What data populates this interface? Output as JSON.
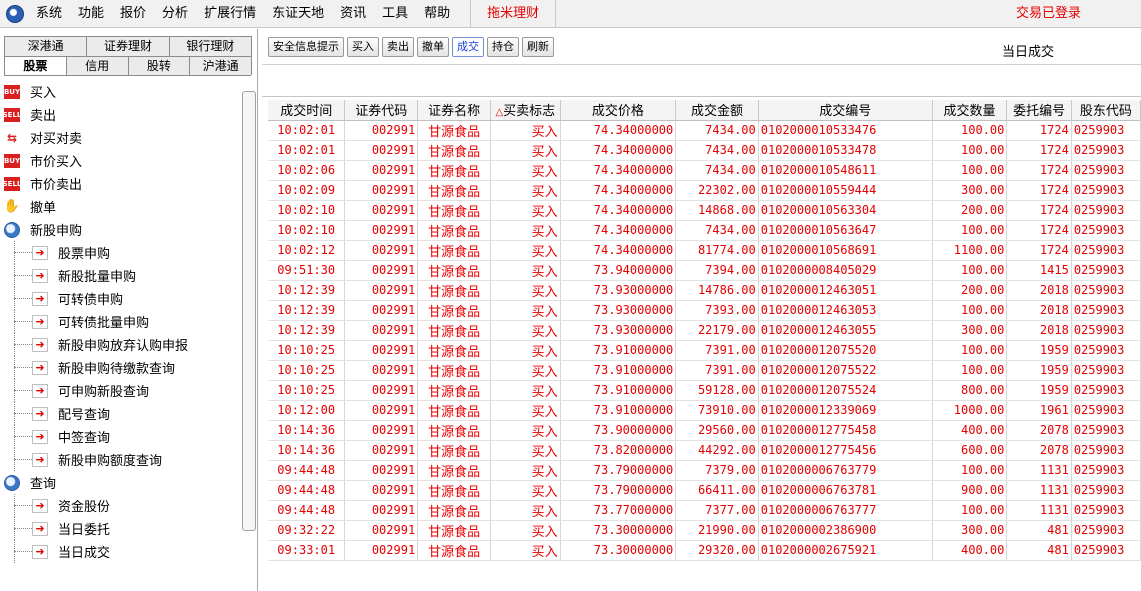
{
  "menubar": {
    "items": [
      "系统",
      "功能",
      "报价",
      "分析",
      "扩展行情",
      "东证天地",
      "资讯",
      "工具",
      "帮助"
    ],
    "tuomi": "拖米理财",
    "login_status": "交易已登录"
  },
  "left": {
    "tabs_row1": [
      "深港通",
      "证券理财",
      "银行理财"
    ],
    "tabs_row2": [
      "股票",
      "信用",
      "股转",
      "沪港通"
    ],
    "tree": [
      {
        "label": "买入",
        "icon": "buy-icon",
        "icon_text": "BUY"
      },
      {
        "label": "卖出",
        "icon": "sell-icon",
        "icon_text": "SELL"
      },
      {
        "label": "对买对卖",
        "icon": "swap-icon",
        "icon_text": "⇆"
      },
      {
        "label": "市价买入",
        "icon": "buy-icon",
        "icon_text": "BUY"
      },
      {
        "label": "市价卖出",
        "icon": "sell-icon",
        "icon_text": "SELL"
      },
      {
        "label": "撤单",
        "icon": "hand-icon",
        "icon_text": "✋"
      },
      {
        "label": "新股申购",
        "icon": "magnifier-icon"
      },
      {
        "label": "股票申购",
        "sub": true
      },
      {
        "label": "新股批量申购",
        "sub": true
      },
      {
        "label": "可转债申购",
        "sub": true
      },
      {
        "label": "可转债批量申购",
        "sub": true
      },
      {
        "label": "新股申购放弃认购申报",
        "sub": true
      },
      {
        "label": "新股申购待缴款查询",
        "sub": true
      },
      {
        "label": "可申购新股查询",
        "sub": true
      },
      {
        "label": "配号查询",
        "sub": true
      },
      {
        "label": "中签查询",
        "sub": true
      },
      {
        "label": "新股申购额度查询",
        "sub": true
      },
      {
        "label": "查询",
        "icon": "magnifier-icon"
      },
      {
        "label": "资金股份",
        "sub": true
      },
      {
        "label": "当日委托",
        "sub": true
      },
      {
        "label": "当日成交",
        "sub": true
      }
    ]
  },
  "toolbar": {
    "buttons": [
      "安全信息提示",
      "买入",
      "卖出",
      "撤单",
      "成交",
      "持仓",
      "刷新"
    ],
    "active_index": 4,
    "title": "当日成交"
  },
  "table": {
    "sort_mark": "△",
    "columns": [
      "成交时间",
      "证券代码",
      "证券名称",
      "买卖标志",
      "成交价格",
      "成交金额",
      "成交编号",
      "成交数量",
      "委托编号",
      "股东代码"
    ],
    "rows": [
      [
        "10:02:01",
        "002991",
        "甘源食品",
        "买入",
        "74.34000000",
        "7434.00",
        "0102000010533476",
        "100.00",
        "1724",
        "0259903"
      ],
      [
        "10:02:01",
        "002991",
        "甘源食品",
        "买入",
        "74.34000000",
        "7434.00",
        "0102000010533478",
        "100.00",
        "1724",
        "0259903"
      ],
      [
        "10:02:06",
        "002991",
        "甘源食品",
        "买入",
        "74.34000000",
        "7434.00",
        "0102000010548611",
        "100.00",
        "1724",
        "0259903"
      ],
      [
        "10:02:09",
        "002991",
        "甘源食品",
        "买入",
        "74.34000000",
        "22302.00",
        "0102000010559444",
        "300.00",
        "1724",
        "0259903"
      ],
      [
        "10:02:10",
        "002991",
        "甘源食品",
        "买入",
        "74.34000000",
        "14868.00",
        "0102000010563304",
        "200.00",
        "1724",
        "0259903"
      ],
      [
        "10:02:10",
        "002991",
        "甘源食品",
        "买入",
        "74.34000000",
        "7434.00",
        "0102000010563647",
        "100.00",
        "1724",
        "0259903"
      ],
      [
        "10:02:12",
        "002991",
        "甘源食品",
        "买入",
        "74.34000000",
        "81774.00",
        "0102000010568691",
        "1100.00",
        "1724",
        "0259903"
      ],
      [
        "09:51:30",
        "002991",
        "甘源食品",
        "买入",
        "73.94000000",
        "7394.00",
        "0102000008405029",
        "100.00",
        "1415",
        "0259903"
      ],
      [
        "10:12:39",
        "002991",
        "甘源食品",
        "买入",
        "73.93000000",
        "14786.00",
        "0102000012463051",
        "200.00",
        "2018",
        "0259903"
      ],
      [
        "10:12:39",
        "002991",
        "甘源食品",
        "买入",
        "73.93000000",
        "7393.00",
        "0102000012463053",
        "100.00",
        "2018",
        "0259903"
      ],
      [
        "10:12:39",
        "002991",
        "甘源食品",
        "买入",
        "73.93000000",
        "22179.00",
        "0102000012463055",
        "300.00",
        "2018",
        "0259903"
      ],
      [
        "10:10:25",
        "002991",
        "甘源食品",
        "买入",
        "73.91000000",
        "7391.00",
        "0102000012075520",
        "100.00",
        "1959",
        "0259903"
      ],
      [
        "10:10:25",
        "002991",
        "甘源食品",
        "买入",
        "73.91000000",
        "7391.00",
        "0102000012075522",
        "100.00",
        "1959",
        "0259903"
      ],
      [
        "10:10:25",
        "002991",
        "甘源食品",
        "买入",
        "73.91000000",
        "59128.00",
        "0102000012075524",
        "800.00",
        "1959",
        "0259903"
      ],
      [
        "10:12:00",
        "002991",
        "甘源食品",
        "买入",
        "73.91000000",
        "73910.00",
        "0102000012339069",
        "1000.00",
        "1961",
        "0259903"
      ],
      [
        "10:14:36",
        "002991",
        "甘源食品",
        "买入",
        "73.90000000",
        "29560.00",
        "0102000012775458",
        "400.00",
        "2078",
        "0259903"
      ],
      [
        "10:14:36",
        "002991",
        "甘源食品",
        "买入",
        "73.82000000",
        "44292.00",
        "0102000012775456",
        "600.00",
        "2078",
        "0259903"
      ],
      [
        "09:44:48",
        "002991",
        "甘源食品",
        "买入",
        "73.79000000",
        "7379.00",
        "0102000006763779",
        "100.00",
        "1131",
        "0259903"
      ],
      [
        "09:44:48",
        "002991",
        "甘源食品",
        "买入",
        "73.79000000",
        "66411.00",
        "0102000006763781",
        "900.00",
        "1131",
        "0259903"
      ],
      [
        "09:44:48",
        "002991",
        "甘源食品",
        "买入",
        "73.77000000",
        "7377.00",
        "0102000006763777",
        "100.00",
        "1131",
        "0259903"
      ],
      [
        "09:32:22",
        "002991",
        "甘源食品",
        "买入",
        "73.30000000",
        "21990.00",
        "0102000002386900",
        "300.00",
        "481",
        "0259903"
      ],
      [
        "09:33:01",
        "002991",
        "甘源食品",
        "买入",
        "73.30000000",
        "29320.00",
        "0102000002675921",
        "400.00",
        "481",
        "0259903"
      ]
    ]
  },
  "colors": {
    "data_text": "#e60000",
    "active_button_text": "#1a3fd6",
    "menu_background": "#f1f1f1"
  }
}
